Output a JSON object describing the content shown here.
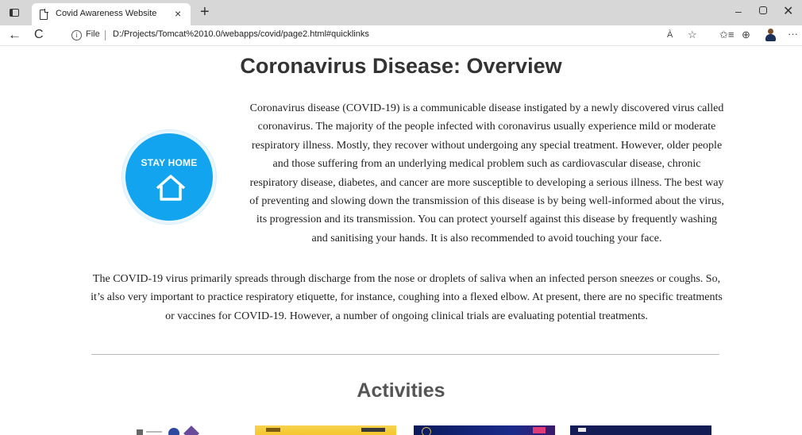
{
  "browser": {
    "tab_title": "Covid Awareness Website",
    "tab_close": "×",
    "new_tab": "+",
    "window_minimize": "–",
    "window_close": "✕",
    "nav_back": "←",
    "nav_refresh": "C",
    "info_glyph": "i",
    "file_label": "File",
    "url": "D:/Projects/Tomcat%2010.0/webapps/covid/page2.html#quicklinks",
    "read_aloud": "À",
    "add_favorite": "☆",
    "favorites": "✩≡",
    "collections": "⊕",
    "more": "···"
  },
  "page": {
    "heading": "Coronavirus Disease: Overview",
    "badge": {
      "text": "STAY HOME",
      "color": "#12a4ee"
    },
    "paragraph1": "Coronavirus disease (COVID-19) is a communicable disease instigated by a newly discovered virus called coronavirus. The majority of the people infected with coronavirus usually experience mild or moderate respiratory illness. Mostly, they recover without undergoing any special treatment. However, older people and those suffering from an underlying medical problem such as cardiovascular disease, chronic respiratory disease, diabetes, and cancer are more susceptible to developing a serious illness. The best way of preventing and slowing down the transmission of this disease is by being well-informed about the virus, its progression and its transmission. You can protect yourself against this disease by frequently washing and sanitising your hands. It is also recommended to avoid touching your face.",
    "paragraph2": "The COVID-19 virus primarily spreads through discharge from the nose or droplets of saliva when an infected person sneezes or coughs. So, it’s also very important to practice respiratory etiquette, for instance, coughing into a flexed elbow. At present, there are no specific treatments or vaccines for COVID-19. However, a number of ongoing clinical trials are evaluating potential treatments.",
    "activities_heading": "Activities"
  }
}
